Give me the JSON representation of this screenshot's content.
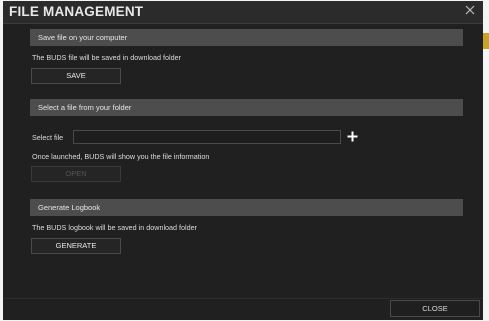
{
  "dialog": {
    "title": "FILE MANAGEMENT",
    "close_icon": "close-icon"
  },
  "save_section": {
    "header": "Save file on your computer",
    "description": "The BUDS file will be saved in download folder",
    "button_label": "SAVE"
  },
  "select_section": {
    "header": "Select a file from your folder",
    "field_label": "Select file",
    "field_value": "",
    "add_icon": "plus-icon",
    "description": "Once launched, BUDS will show you the file information",
    "button_label": "OPEN",
    "button_state": "disabled"
  },
  "logbook_section": {
    "header": "Generate Logbook",
    "description": "The BUDS logbook will be saved in download folder",
    "button_label": "GENERATE"
  },
  "footer": {
    "close_label": "CLOSE"
  },
  "colors": {
    "dialog_background": "#202020",
    "section_bar": "#4d4d4d",
    "accent": "#c9a227"
  }
}
